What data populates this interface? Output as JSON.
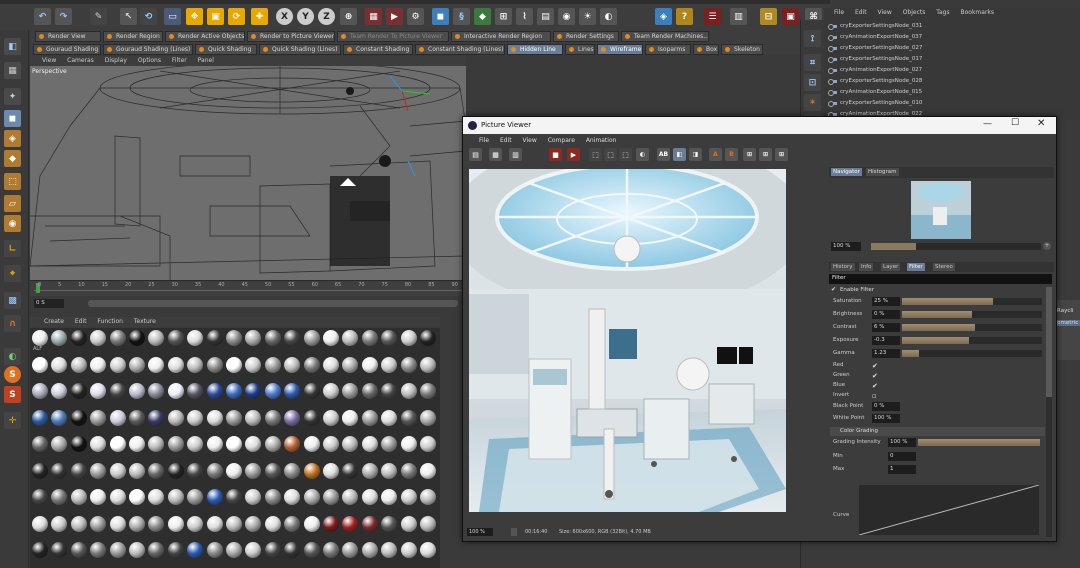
{
  "c4d": {
    "render_tabs": [
      "Render View",
      "Render Region",
      "Render Active Objects",
      "Render to Picture Viewer",
      "Team Render To Picture Viewer",
      "Interactive Render Region",
      "Render Settings",
      "Team Render Machines..."
    ],
    "shading_tabs": [
      "Gouraud Shading",
      "Gouraud Shading (Lines)",
      "Quick Shading",
      "Quick Shading (Lines)",
      "Constant Shading",
      "Constant Shading (Lines)",
      "Hidden Line",
      "Lines",
      "Wireframe",
      "Isoparms",
      "Box",
      "Skeleton"
    ],
    "toolbar_letters": [
      "X",
      "Y",
      "Z"
    ],
    "viewport": {
      "menu": [
        "View",
        "Cameras",
        "Display",
        "Options",
        "Filter",
        "Panel"
      ],
      "label": "Perspective"
    },
    "timeline": {
      "frame": "0 S",
      "ticks": [
        "0",
        "5",
        "10",
        "15",
        "20",
        "25",
        "30",
        "35",
        "40",
        "45",
        "50",
        "55",
        "60",
        "65",
        "70",
        "75",
        "80",
        "85",
        "90"
      ]
    },
    "material_manager": {
      "menu": [
        "Create",
        "Edit",
        "Function",
        "Texture"
      ],
      "first_label": "ALF"
    },
    "object_manager": {
      "menu": [
        "File",
        "Edit",
        "View",
        "Objects",
        "Tags",
        "Bookmarks"
      ],
      "items": [
        "cryExporterSettingsNode_031",
        "cryAnimationExportNode_037",
        "cryExporterSettingsNode_027",
        "cryExporterSettingsNode_017",
        "cryAnimationExportNode_027",
        "cryExporterSettingsNode_028",
        "cryAnimationExportNode_015",
        "cryExporterSettingsNode_010",
        "cryAnimationExportNode_022"
      ]
    },
    "right_edge": [
      "Raycli",
      "rometric"
    ]
  },
  "picture_viewer": {
    "title": "Picture Viewer",
    "menu": [
      "File",
      "Edit",
      "View",
      "Compare",
      "Animation"
    ],
    "tabs_top": [
      "Navigator",
      "Histogram"
    ],
    "zoom": "100 %",
    "tabs_mid": [
      "History",
      "Info",
      "Layer",
      "Filter",
      "Stereo"
    ],
    "filter_header": "Filter",
    "enable_filter": "Enable Filter",
    "controls": [
      {
        "name": "Saturation",
        "value": "25 %",
        "level": 0.65
      },
      {
        "name": "Brightness",
        "value": "0 %",
        "level": 0.5
      },
      {
        "name": "Contrast",
        "value": "6 %",
        "level": 0.52
      },
      {
        "name": "Exposure",
        "value": "-0.3",
        "level": 0.48
      },
      {
        "name": "Gamma",
        "value": "1.23",
        "level": 0.12
      }
    ],
    "checks": [
      {
        "name": "Red",
        "checked": true
      },
      {
        "name": "Green",
        "checked": true
      },
      {
        "name": "Blue",
        "checked": true
      },
      {
        "name": "Invert",
        "checked": false
      }
    ],
    "black_point": {
      "name": "Black Point",
      "value": "0 %"
    },
    "white_point": {
      "name": "White Point",
      "value": "100 %"
    },
    "color_grading": "Color Grading",
    "grading_intensity": {
      "name": "Grading Intensity",
      "value": "100 %"
    },
    "min": {
      "name": "Min",
      "value": "0"
    },
    "max": {
      "name": "Max",
      "value": "1"
    },
    "curve": "Curve",
    "status": {
      "zoom": "100 %",
      "time": "00:16:40",
      "info": "Size: 600x600, RGB (32Bit), 4.70 MB"
    }
  },
  "colors": {
    "accent": "#e08a20",
    "selected_tab": "#6a7c96",
    "window_bg": "#3c3c3c"
  }
}
